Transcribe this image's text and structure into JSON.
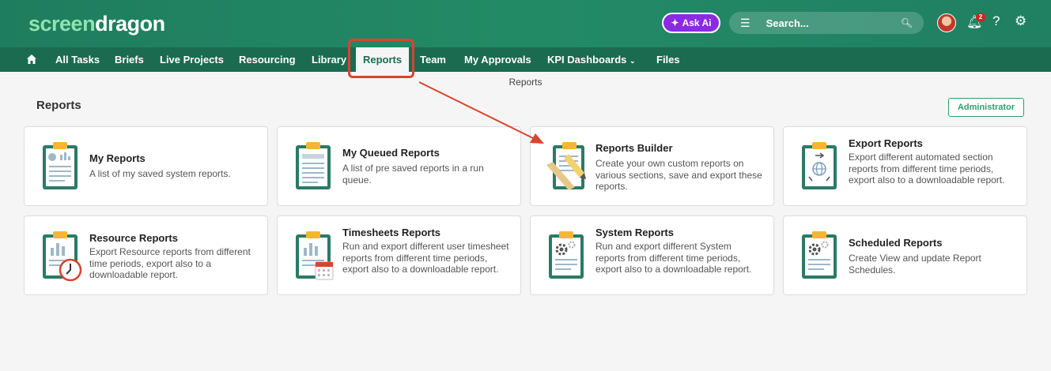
{
  "header": {
    "logo_part1": "screen",
    "logo_part2": "dragon",
    "ask_ai_label": "Ask Ai",
    "search_placeholder": "Search...",
    "notification_count": "2"
  },
  "nav": {
    "items": [
      "All Tasks",
      "Briefs",
      "Live Projects",
      "Resourcing",
      "Library",
      "Reports",
      "Team",
      "My Approvals",
      "KPI Dashboards",
      "Files"
    ],
    "active": "Reports"
  },
  "breadcrumb": "Reports",
  "page": {
    "title": "Reports",
    "admin_label": "Administrator"
  },
  "cards": [
    {
      "title": "My Reports",
      "desc": "A list of my saved system reports."
    },
    {
      "title": "My Queued Reports",
      "desc": "A list of pre saved reports in a run queue."
    },
    {
      "title": "Reports Builder",
      "desc": "Create your own custom reports on various sections, save and export these reports."
    },
    {
      "title": "Export Reports",
      "desc": "Export different automated section reports from different time periods, export also to a downloadable report."
    },
    {
      "title": "Resource Reports",
      "desc": "Export Resource reports from different time periods, export also to a downloadable report."
    },
    {
      "title": "Timesheets Reports",
      "desc": "Run and export different user timesheet reports from different time periods, export also to a downloadable report."
    },
    {
      "title": "System Reports",
      "desc": "Run and export different System reports from different time periods, export also to a downloadable report."
    },
    {
      "title": "Scheduled Reports",
      "desc": "Create View and update Report Schedules."
    }
  ],
  "colors": {
    "brand_green": "#1e7d5e",
    "nav_green": "#1b6b50",
    "accent_purple": "#8a2be2",
    "annotation_red": "#d9442f"
  }
}
